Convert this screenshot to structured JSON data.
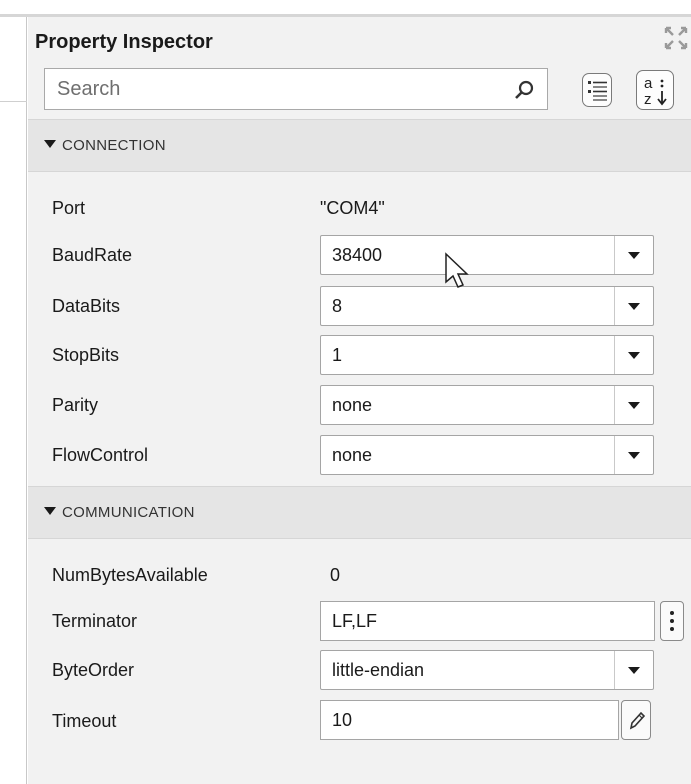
{
  "panel": {
    "title": "Property Inspector",
    "undock_icon": "undock-icon"
  },
  "search": {
    "placeholder": "Search",
    "icon": "search-icon",
    "grouped_view_icon": "grouped-list-icon",
    "alpha_sort_icon": "sort-alphabetical-icon"
  },
  "sections": [
    {
      "label": "CONNECTION",
      "properties": [
        {
          "name": "Port",
          "value": "\"COM4\"",
          "control": "readonly"
        },
        {
          "name": "BaudRate",
          "value": "38400",
          "control": "dropdown"
        },
        {
          "name": "DataBits",
          "value": "8",
          "control": "dropdown"
        },
        {
          "name": "StopBits",
          "value": "1",
          "control": "dropdown"
        },
        {
          "name": "Parity",
          "value": "none",
          "control": "dropdown"
        },
        {
          "name": "FlowControl",
          "value": "none",
          "control": "dropdown"
        }
      ]
    },
    {
      "label": "COMMUNICATION",
      "properties": [
        {
          "name": "NumBytesAvailable",
          "value": "0",
          "control": "readonly"
        },
        {
          "name": "Terminator",
          "value": "LF,LF",
          "control": "text-with-menu"
        },
        {
          "name": "ByteOrder",
          "value": "little-endian",
          "control": "dropdown"
        },
        {
          "name": "Timeout",
          "value": "10",
          "control": "text-with-edit"
        }
      ]
    }
  ]
}
